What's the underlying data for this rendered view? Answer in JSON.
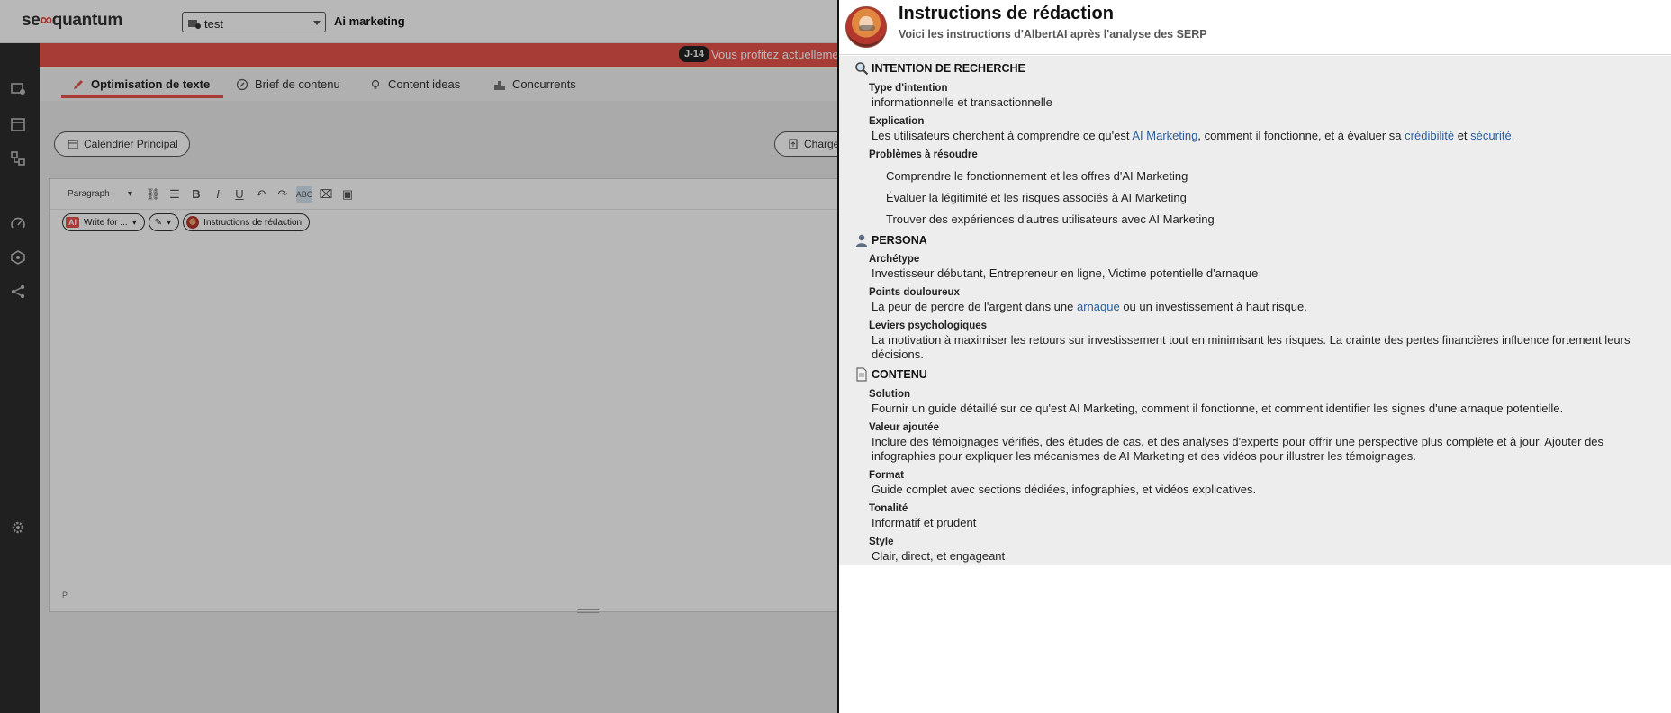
{
  "app": {
    "logo_prefix": "se",
    "logo_accent": "∞",
    "logo_suffix": "quantum",
    "project_select_value": "test",
    "project_name": "Ai marketing",
    "brand_color": "#e8524a"
  },
  "promo": {
    "badge": "J-14",
    "text": "Vous profitez actuelleme"
  },
  "tabs": [
    {
      "label": "Optimisation de texte"
    },
    {
      "label": "Brief de contenu"
    },
    {
      "label": "Content ideas"
    },
    {
      "label": "Concurrents"
    }
  ],
  "work": {
    "calendar_button": "Calendrier Principal",
    "charge_button": "Charge"
  },
  "editor": {
    "paragraph_select": "Paragraph",
    "spellcheck_label": "ABC",
    "write_pill": "Write for ...",
    "ai_badge": "AI",
    "instructions_pill": "Instructions de rédaction",
    "status_path": "P"
  },
  "panel": {
    "title": "Instructions de rédaction",
    "subtitle": "Voici les instructions d'AlbertAI après l'analyse des SERP",
    "sections": {
      "intention": {
        "heading": "INTENTION DE RECHERCHE",
        "type_label": "Type d'intention",
        "type_value": "informationnelle et transactionnelle",
        "explication_label": "Explication",
        "explication_parts": [
          "Les utilisateurs cherchent à comprendre ce qu'est ",
          "AI Marketing",
          ", comment il fonctionne, et à évaluer sa ",
          "crédibilité",
          " et ",
          "sécurité",
          "."
        ],
        "problemes_label": "Problèmes à résoudre",
        "problemes": [
          "Comprendre le fonctionnement et les offres d'AI Marketing",
          "Évaluer la légitimité et les risques associés à AI Marketing",
          "Trouver des expériences d'autres utilisateurs avec AI Marketing"
        ]
      },
      "persona": {
        "heading": "PERSONA",
        "archetype_label": "Archétype",
        "archetype_value": "Investisseur débutant, Entrepreneur en ligne, Victime potentielle d'arnaque",
        "points_label": "Points douloureux",
        "points_parts": [
          "La peur de perdre de l'argent dans une ",
          "arnaque",
          " ou un investissement à haut risque."
        ],
        "leviers_label": "Leviers psychologiques",
        "leviers_value": "La motivation à maximiser les retours sur investissement tout en minimisant les risques. La crainte des pertes financières influence fortement leurs décisions."
      },
      "contenu": {
        "heading": "CONTENU",
        "solution_label": "Solution",
        "solution_value": "Fournir un guide détaillé sur ce qu'est AI Marketing, comment il fonctionne, et comment identifier les signes d'une arnaque potentielle.",
        "valeur_label": "Valeur ajoutée",
        "valeur_value": "Inclure des témoignages vérifiés, des études de cas, et des analyses d'experts pour offrir une perspective plus complète et à jour. Ajouter des infographies pour expliquer les mécanismes de AI Marketing et des vidéos pour illustrer les témoignages.",
        "format_label": "Format",
        "format_value": "Guide complet avec sections dédiées, infographies, et vidéos explicatives.",
        "tonalite_label": "Tonalité",
        "tonalite_value": "Informatif et prudent",
        "style_label": "Style",
        "style_value": "Clair, direct, et engageant"
      }
    }
  }
}
